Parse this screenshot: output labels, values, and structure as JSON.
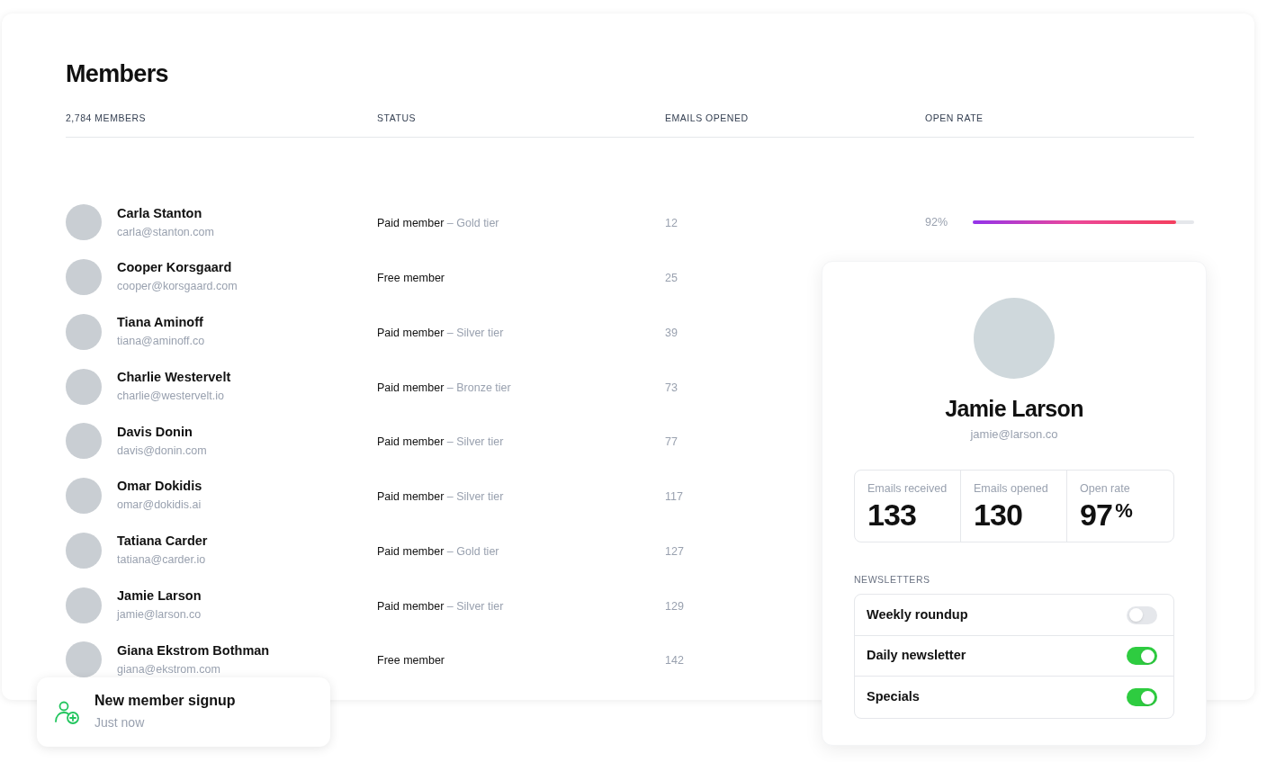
{
  "title": "Members",
  "table": {
    "columns": [
      "2,784 MEMBERS",
      "STATUS",
      "EMAILS OPENED",
      "OPEN RATE"
    ],
    "rows": [
      {
        "name": "Carla Stanton",
        "email": "carla@stanton.com",
        "status": "Paid member",
        "tier": "– Gold tier",
        "emails_opened": "12",
        "open_rate": "92%",
        "level": 0.92
      },
      {
        "name": "Cooper Korsgaard",
        "email": "cooper@korsgaard.com",
        "status": "Free member",
        "emails_opened": "25"
      },
      {
        "name": "Tiana Aminoff",
        "email": "tiana@aminoff.co",
        "status": "Paid member",
        "tier": "– Silver tier",
        "emails_opened": "39"
      },
      {
        "name": "Charlie Westervelt",
        "email": "charlie@westervelt.io",
        "status": "Paid member",
        "tier": "– Bronze tier",
        "emails_opened": "73"
      },
      {
        "name": "Davis Donin",
        "email": "davis@donin.com",
        "status": "Paid member",
        "tier": "– Silver tier",
        "emails_opened": "77"
      },
      {
        "name": "Omar Dokidis",
        "email": "omar@dokidis.ai",
        "status": "Paid member",
        "tier": "– Silver tier",
        "emails_opened": "117"
      },
      {
        "name": "Tatiana Carder",
        "email": "tatiana@carder.io",
        "status": "Paid member",
        "tier": "– Gold tier",
        "emails_opened": "127"
      },
      {
        "name": "Jamie Larson",
        "email": "jamie@larson.co",
        "status": "Paid member",
        "tier": "– Silver tier",
        "emails_opened": "129"
      },
      {
        "name": "Giana Ekstrom Bothman",
        "email": "giana@ekstrom.com",
        "status": "Free member",
        "emails_opened": "142"
      }
    ]
  },
  "profile": {
    "name": "Jamie Larson",
    "email": "jamie@larson.co",
    "stats": [
      {
        "label": "Emails received",
        "value": "133"
      },
      {
        "label": "Emails opened",
        "value": "130"
      },
      {
        "label": "Open rate",
        "value": "97",
        "unit": "%"
      }
    ],
    "newsletters_label": "NEWSLETTERS",
    "newsletters": [
      {
        "label": "Weekly roundup",
        "on": false
      },
      {
        "label": "Daily newsletter",
        "on": true
      },
      {
        "label": "Specials",
        "on": true
      }
    ]
  },
  "notification": {
    "title": "New member signup",
    "time": "Just now"
  }
}
